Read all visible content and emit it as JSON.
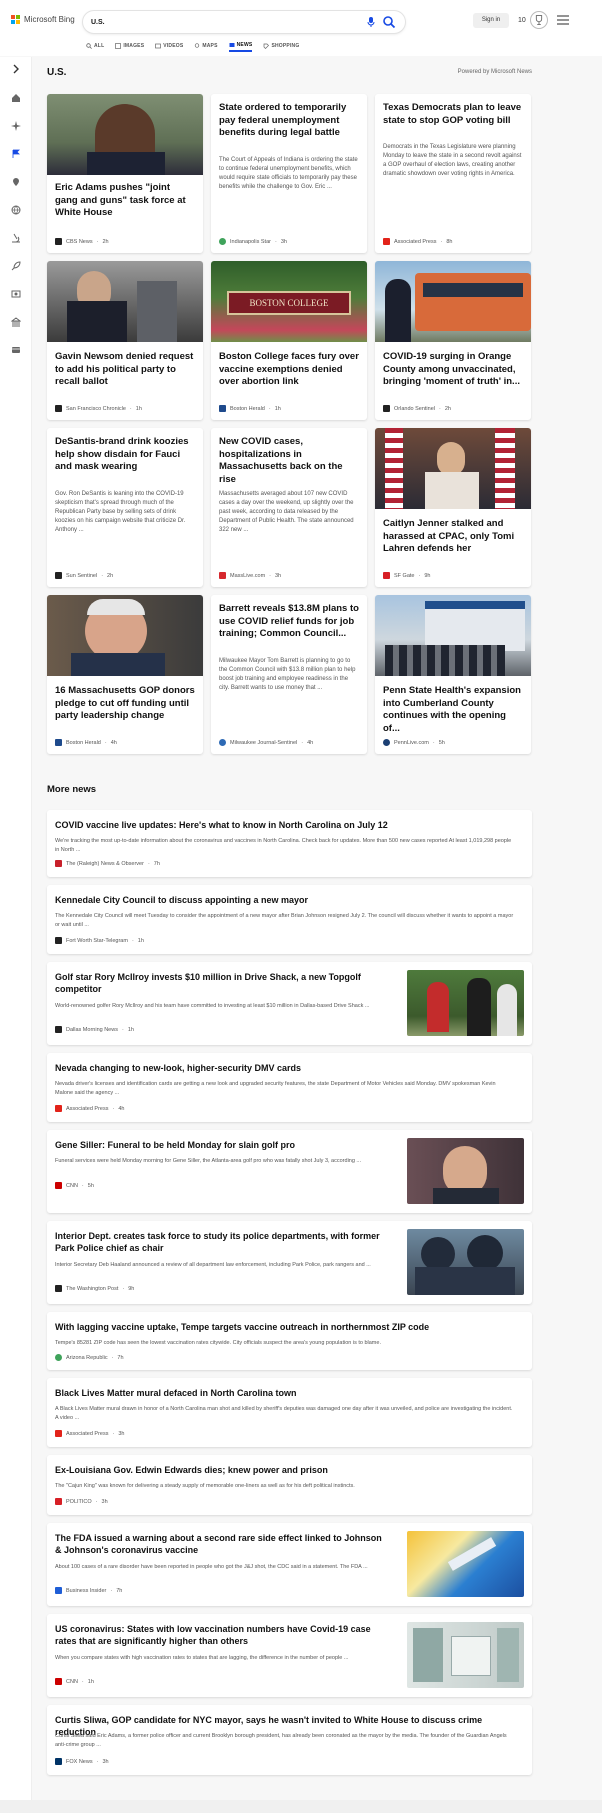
{
  "header": {
    "brand": "Microsoft Bing",
    "query": "U.S.",
    "signin": "Sign in",
    "rewards": "10"
  },
  "tabs": [
    {
      "label": "ALL"
    },
    {
      "label": "IMAGES"
    },
    {
      "label": "VIDEOS"
    },
    {
      "label": "MAPS"
    },
    {
      "label": "NEWS",
      "active": true
    },
    {
      "label": "SHOPPING"
    }
  ],
  "section": {
    "title": "U.S.",
    "powered": "Powered by Microsoft News"
  },
  "cards": [
    {
      "title": "Eric Adams pushes \"joint gang and guns\" task force at White House",
      "source": "CBS News",
      "time": "2h",
      "img": "portrait"
    },
    {
      "title": "State ordered to temporarily pay federal unemployment benefits during legal battle",
      "snippet": "The Court of Appeals of Indiana is ordering the state to continue federal unemployment benefits, which would require state officials to temporarily pay these benefits while the challenge to Gov. Eric ...",
      "source": "Indianapolis Star",
      "time": "3h"
    },
    {
      "title": "Texas Democrats plan to leave state to stop GOP voting bill",
      "snippet": "Democrats in the Texas Legislature were planning Monday to leave the state in a second revolt against a GOP overhaul of election laws, creating another dramatic showdown over voting rights in America.",
      "source": "Associated Press",
      "time": "8h"
    },
    {
      "title": "Gavin Newsom denied request to add his political party to recall ballot",
      "source": "San Francisco Chronicle",
      "time": "1h",
      "img": "crowd"
    },
    {
      "title": "Boston College faces fury over vaccine exemptions denied over abortion link",
      "source": "Boston Herald",
      "time": "1h",
      "img": "sign",
      "sign": "BOSTON COLLEGE"
    },
    {
      "title": "COVID-19 surging in Orange County among unvaccinated, bringing 'moment of truth' in...",
      "source": "Orlando Sentinel",
      "time": "2h",
      "img": "bus"
    },
    {
      "title": "DeSantis-brand drink koozies help show disdain for Fauci and mask wearing",
      "snippet": "Gov. Ron DeSantis is leaning into the COVID-19 skepticism that's spread through much of the Republican Party base by selling sets of drink koozies on his campaign website that criticize Dr. Anthony ...",
      "source": "Sun Sentinel",
      "time": "2h"
    },
    {
      "title": "New COVID cases, hospitalizations in Massachusetts back on the rise",
      "snippet": "Massachusetts averaged about 107 new COVID cases a day over the weekend, up slightly over the past week, according to data released by the Department of Public Health. The state announced 322 new ...",
      "source": "MassLive.com",
      "time": "3h"
    },
    {
      "title": "Caitlyn Jenner stalked and harassed at CPAC, only Tomi Lahren defends her",
      "source": "SF Gate",
      "time": "9h",
      "img": "flags"
    },
    {
      "title": "16 Massachusetts GOP donors pledge to cut off funding until party leadership change",
      "source": "Boston Herald",
      "time": "4h",
      "img": "elder"
    },
    {
      "title": "Barrett reveals $13.8M plans to use COVID relief funds for job training; Common Council...",
      "snippet": "Milwaukee Mayor Tom Barrett is planning to go to the Common Council with $13.8 million plan to help boost job training and employee readiness in the city.  Barrett wants to use money that ...",
      "source": "Milwaukee Journal-Sentinel",
      "time": "4h"
    },
    {
      "title": "Penn State Health's expansion into Cumberland County continues with the opening of...",
      "source": "PennLive.com",
      "time": "5h",
      "img": "building"
    }
  ],
  "more_news": {
    "title": "More news",
    "items": [
      {
        "title": "COVID vaccine live updates: Here's what to know in North Carolina on July 12",
        "snippet": "We're tracking the most up-to-date information about the coronavirus and vaccines in North Carolina. Check back for updates. More than 500 new cases reported At least 1,019,298 people in North ...",
        "source": "The (Raleigh) News & Observer",
        "time": "7h"
      },
      {
        "title": "Kennedale City Council to discuss appointing a new mayor",
        "snippet": "The Kennedale City Council will meet Tuesday to consider the appointment of a new mayor after Brian Johnson resigned July 2. The council will discuss whether it wants to appoint a mayor or wait until ...",
        "source": "Fort Worth Star-Telegram",
        "time": "1h"
      },
      {
        "title": "Golf star Rory McIlroy invests $10 million in Drive Shack, a new Topgolf competitor",
        "snippet": "World-renowned golfer Rory McIlroy and his team have committed to investing at least $10 million in Dallas-based Drive Shack ...",
        "source": "Dallas Morning News",
        "time": "1h",
        "thumb": "golf"
      },
      {
        "title": "Nevada changing to new-look, higher-security DMV cards",
        "snippet": "Nevada driver's licenses and identification cards are getting a new look and upgraded security features, the state Department of Motor Vehicles said Monday. DMV spokesman Kevin Malone said the agency ...",
        "source": "Associated Press",
        "time": "4h"
      },
      {
        "title": "Gene Siller: Funeral to be held Monday for slain golf pro",
        "snippet": "Funeral services were held Monday morning for Gene Siller, the Atlanta-area golf pro who was fatally shot July 3, according ...",
        "source": "CNN",
        "time": "5h",
        "thumb": "face"
      },
      {
        "title": "Interior Dept. creates task force to study its police departments, with former Park Police chief as chair",
        "snippet": "Interior Secretary Deb Haaland announced a review of all department law enforcement, including Park Police, park rangers and ...",
        "source": "The Washington Post",
        "time": "9h",
        "thumb": "police"
      },
      {
        "title": "With lagging vaccine uptake, Tempe targets vaccine outreach in northernmost ZIP code",
        "snippet": "Tempe's 85281 ZIP code has seen the lowest vaccination rates citywide. City officials suspect the area's young population is to blame.",
        "source": "Arizona Republic",
        "time": "7h"
      },
      {
        "title": "Black Lives Matter mural defaced in North Carolina town",
        "snippet": "A Black Lives Matter mural drawn in honor of a North Carolina man shot and killed by sheriff's deputies was damaged one day after it was unveiled, and police are investigating the incident. A video ...",
        "source": "Associated Press",
        "time": "3h"
      },
      {
        "title": "Ex-Louisiana Gov. Edwin Edwards dies; knew power and prison",
        "snippet": "The \"Cajun King\" was known for delivering a steady supply of memorable one-liners as well as for his deft political instincts.",
        "source": "POLITICO",
        "time": "3h"
      },
      {
        "title": "The FDA issued a warning about a second rare side effect linked to Johnson & Johnson's coronavirus vaccine",
        "snippet": "About 100 cases of a rare disorder have been reported in people who got the J&J shot, the CDC said in a statement. The FDA ...",
        "source": "Business Insider",
        "time": "7h",
        "thumb": "vaccine"
      },
      {
        "title": "US coronavirus: States with low vaccination numbers have Covid-19 case rates that are significantly higher than others",
        "snippet": "When you compare states with high vaccination rates to states that are lagging, the difference in the number of people ...",
        "source": "CNN",
        "time": "1h",
        "thumb": "hospital"
      },
      {
        "title": "Curtis Sliwa, GOP candidate for NYC mayor, says he wasn't invited to White House to discuss crime reduction",
        "snippet": "Curtis Sliwa said Eric Adams, a former police officer and current Brooklyn borough president, has already been coronated as the mayor by the media. The founder of the Guardian Angels anti-crime group ...",
        "source": "FOX News",
        "time": "3h"
      }
    ]
  }
}
